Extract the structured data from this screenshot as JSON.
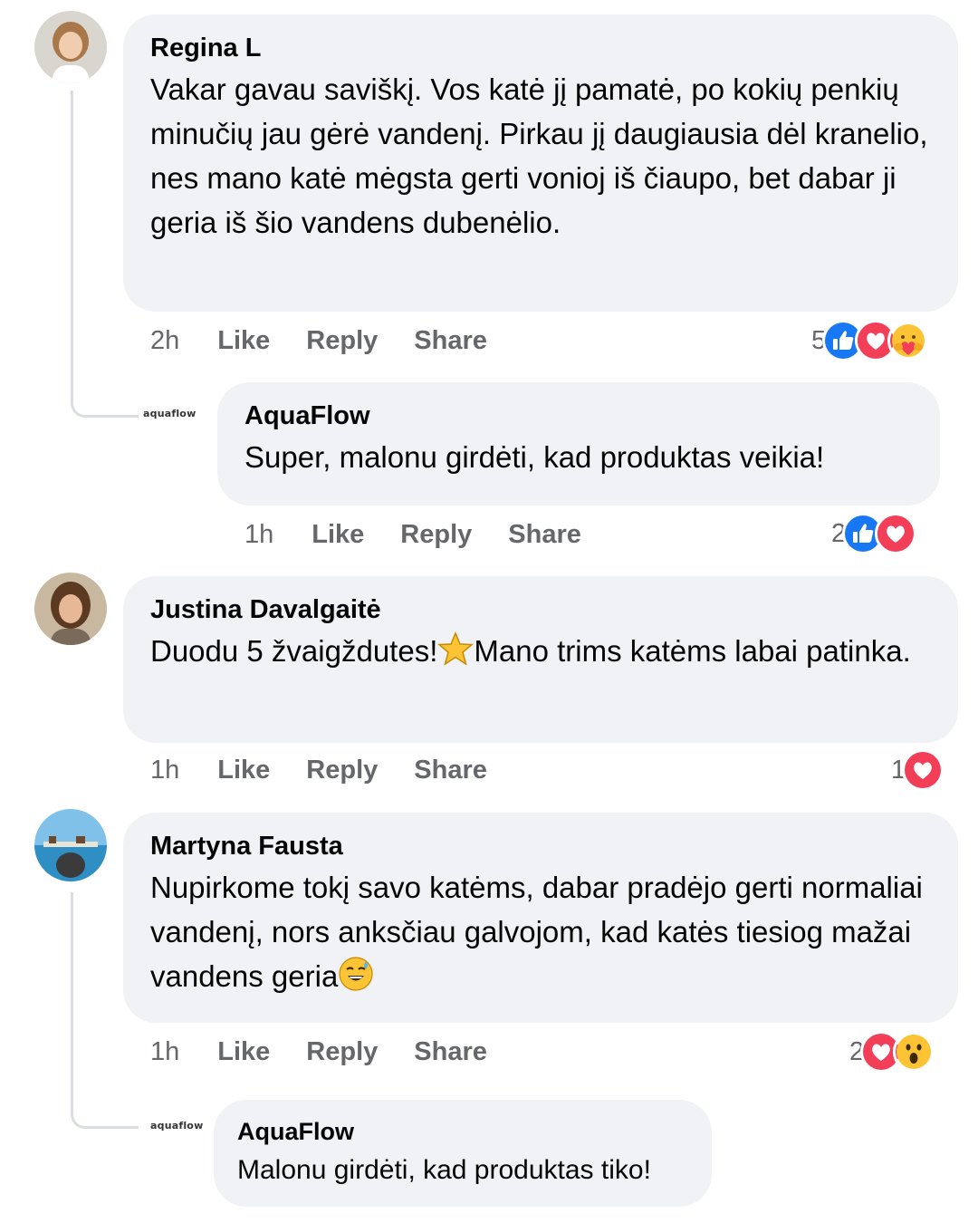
{
  "comments": [
    {
      "author": "Regina L",
      "text": "Vakar gavau saviškį. Vos katė jį pamatė, po kokių penkių minučių jau gėrė vandenį. Pirkau jį daugiausia dėl kranelio, nes mano katė mėgsta gerti vonioj iš čiaupo, bet dabar ji geria iš šio vandens dubenėlio.",
      "time": "2h",
      "like": "Like",
      "reply": "Reply",
      "share": "Share",
      "reaction_count": "5",
      "reactions": [
        "like-icon",
        "love-icon",
        "care-icon"
      ],
      "replies": [
        {
          "author": "AquaFlow",
          "brand_mark": "aquaflow",
          "text": "Super, malonu girdėti, kad produktas veikia!",
          "time": "1h",
          "like": "Like",
          "reply": "Reply",
          "share": "Share",
          "reaction_count": "2",
          "reactions": [
            "like-icon",
            "love-icon"
          ]
        }
      ]
    },
    {
      "author": "Justina Davalgaitė",
      "text_before": "Duodu 5 žvaigždutes!",
      "text_after": "Mano trims katėms labai patinka.",
      "inline_emoji": "star-emoji-icon",
      "time": "1h",
      "like": "Like",
      "reply": "Reply",
      "share": "Share",
      "reaction_count": "1",
      "reactions": [
        "love-icon"
      ]
    },
    {
      "author": "Martyna Fausta",
      "text": "Nupirkome tokį savo katėms, dabar pradėjo gerti normaliai vandenį, nors anksčiau galvojom, kad katės tiesiog mažai vandens geria",
      "inline_emoji": "sweat-smile-emoji-icon",
      "time": "1h",
      "like": "Like",
      "reply": "Reply",
      "share": "Share",
      "reaction_count": "2",
      "reactions": [
        "love-icon",
        "wow-icon"
      ],
      "replies": [
        {
          "author": "AquaFlow",
          "brand_mark": "aquaflow",
          "text": "Malonu girdėti, kad produktas tiko!"
        }
      ]
    }
  ],
  "colors": {
    "bubble": "#f0f2f5",
    "meta": "#65676b",
    "like_blue": "#1877f2",
    "love_red": "#f33e58",
    "emoji_yellow": "#fcc434"
  }
}
